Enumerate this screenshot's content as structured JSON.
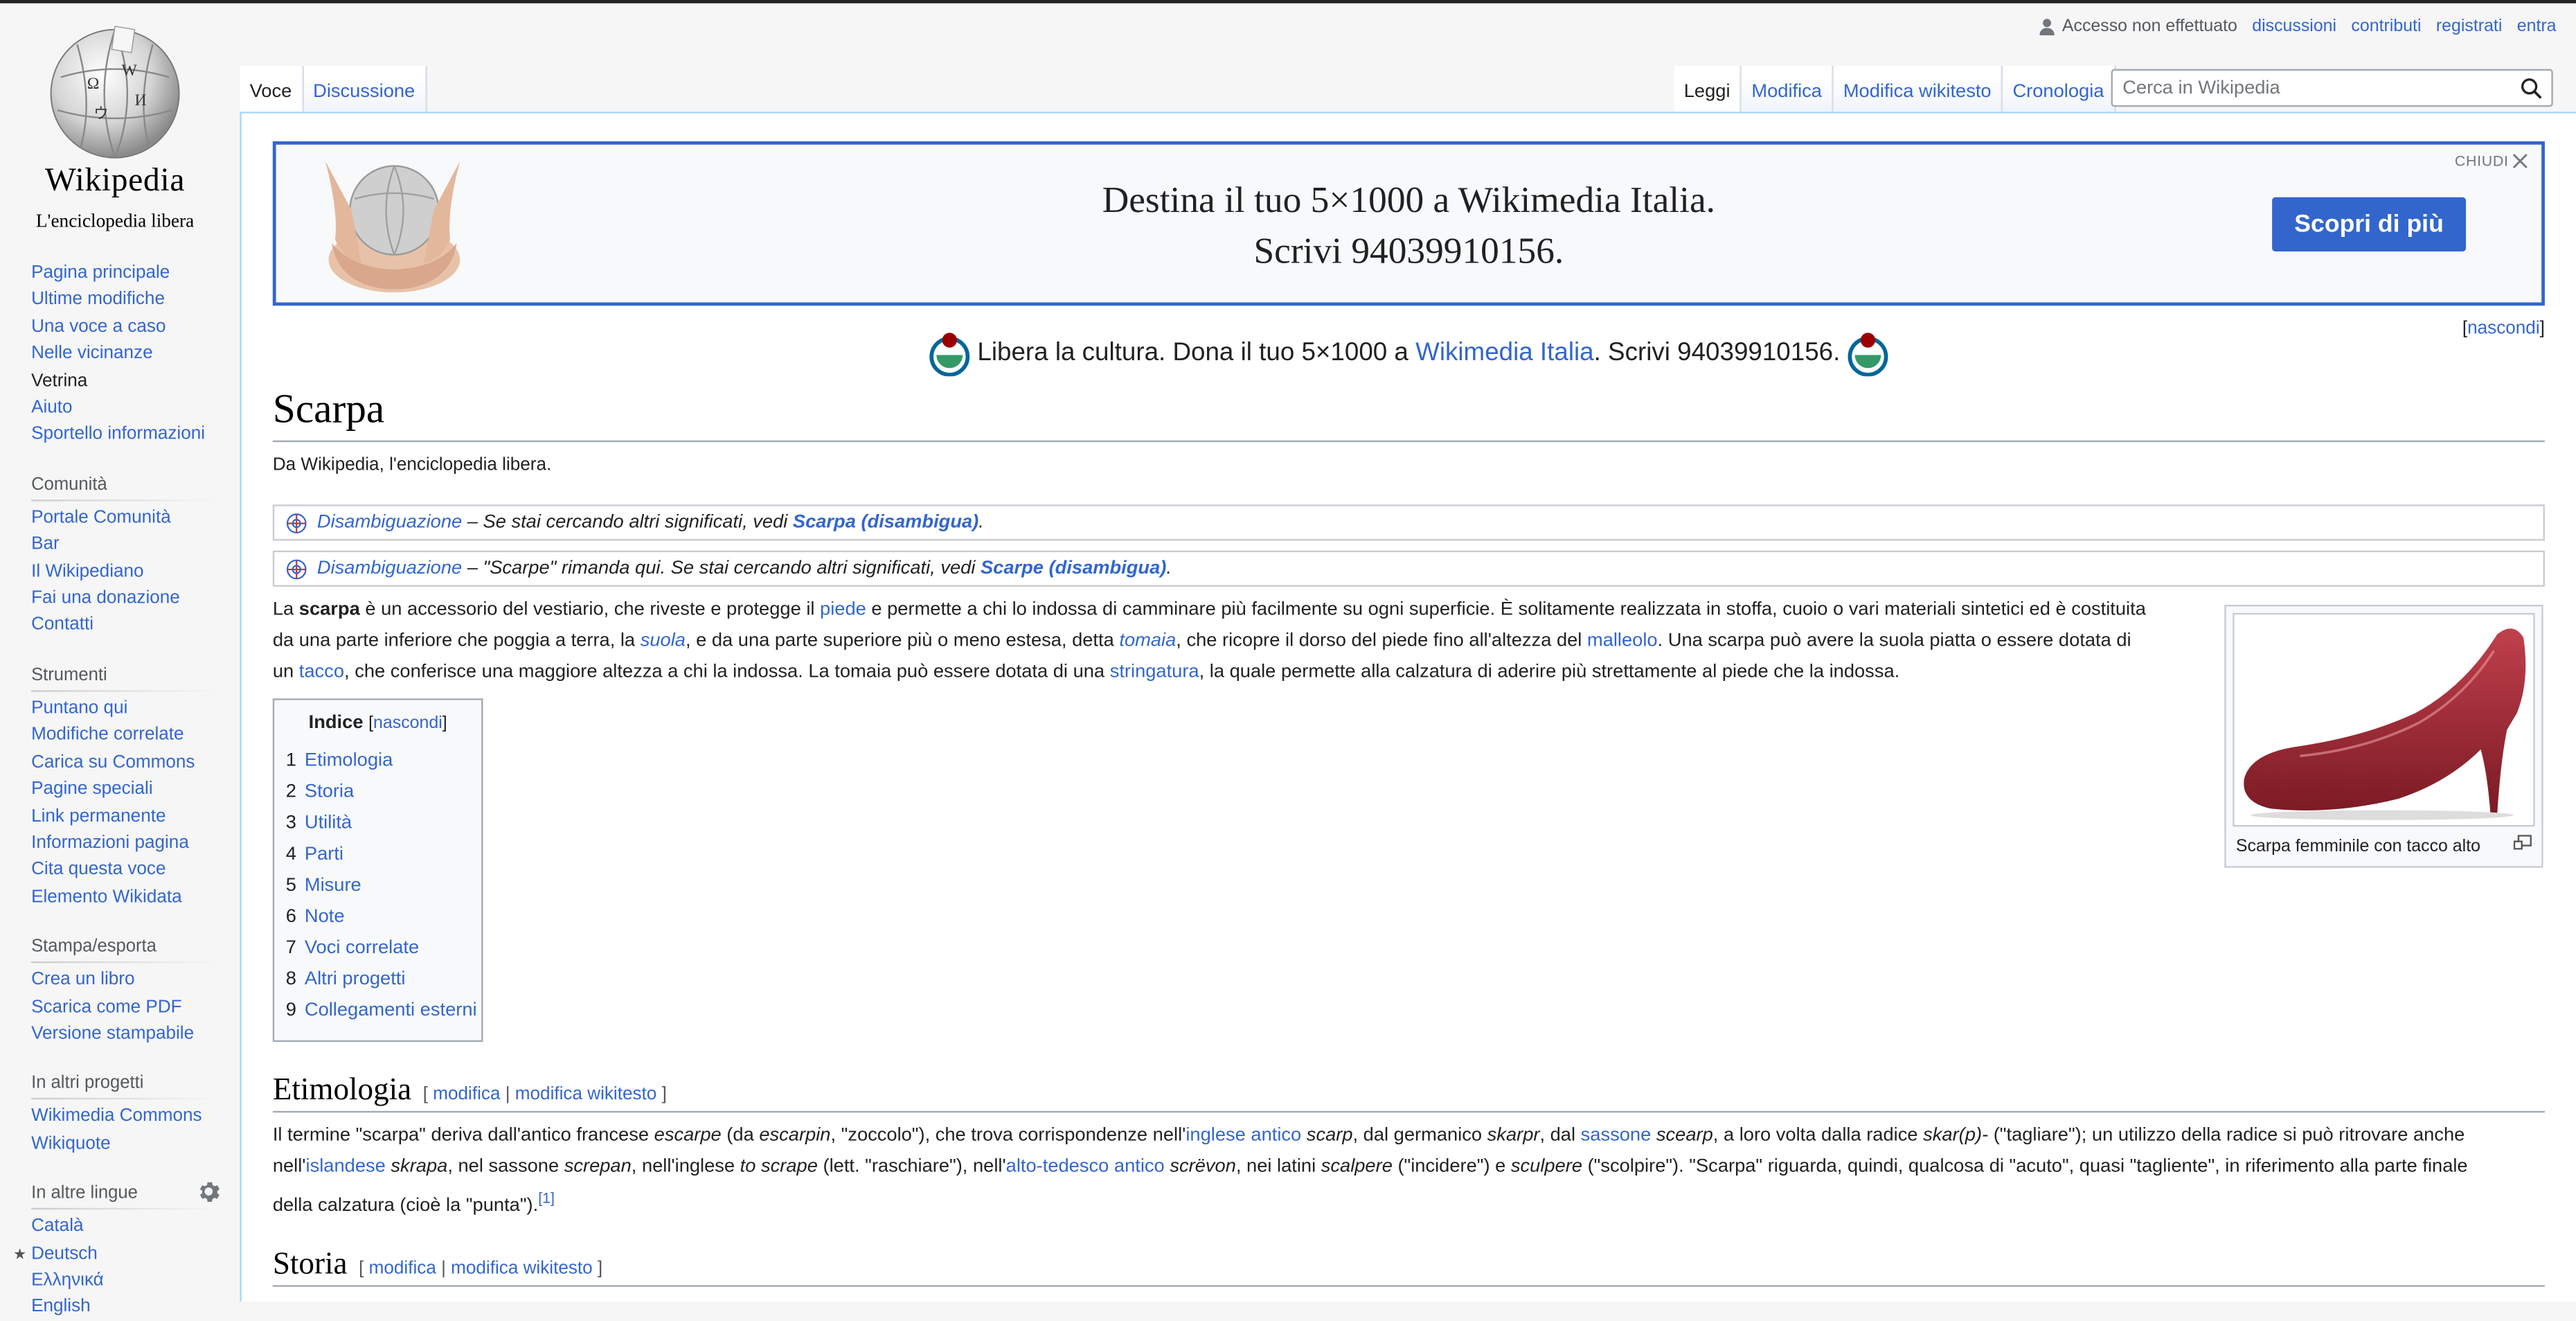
{
  "logo": {
    "wordmark": "Wikipedia",
    "tagline": "L'enciclopedia libera"
  },
  "sidebar": {
    "nav": [
      {
        "label": "Pagina principale",
        "plain": false
      },
      {
        "label": "Ultime modifiche",
        "plain": false
      },
      {
        "label": "Una voce a caso",
        "plain": false
      },
      {
        "label": "Nelle vicinanze",
        "plain": false
      },
      {
        "label": "Vetrina",
        "plain": true
      },
      {
        "label": "Aiuto",
        "plain": false
      },
      {
        "label": "Sportello informazioni",
        "plain": false
      }
    ],
    "community_heading": "Comunità",
    "community": [
      "Portale Comunità",
      "Bar",
      "Il Wikipediano",
      "Fai una donazione",
      "Contatti"
    ],
    "tools_heading": "Strumenti",
    "tools": [
      "Puntano qui",
      "Modifiche correlate",
      "Carica su Commons",
      "Pagine speciali",
      "Link permanente",
      "Informazioni pagina",
      "Cita questa voce",
      "Elemento Wikidata"
    ],
    "print_heading": "Stampa/esporta",
    "print": [
      "Crea un libro",
      "Scarica come PDF",
      "Versione stampabile"
    ],
    "projects_heading": "In altri progetti",
    "projects": [
      "Wikimedia Commons",
      "Wikiquote"
    ],
    "langs_heading": "In altre lingue",
    "langs": [
      "Català",
      "Deutsch",
      "Ελληνικά",
      "English"
    ]
  },
  "personal": {
    "anon": "Accesso non effettuato",
    "links": [
      "discussioni",
      "contributi",
      "registrati",
      "entra"
    ]
  },
  "tabs": {
    "left": [
      {
        "label": "Voce",
        "selected": true
      },
      {
        "label": "Discussione",
        "selected": false
      }
    ],
    "right": [
      {
        "label": "Leggi",
        "selected": true
      },
      {
        "label": "Modifica",
        "selected": false
      },
      {
        "label": "Modifica wikitesto",
        "selected": false
      },
      {
        "label": "Cronologia",
        "selected": false
      }
    ]
  },
  "search": {
    "placeholder": "Cerca in Wikipedia"
  },
  "banner": {
    "line1": "Destina il tuo 5×1000 a Wikimedia Italia.",
    "line2": "Scrivi 94039910156.",
    "cta": "Scopri di più",
    "close": "CHIUDI"
  },
  "sitenotice": {
    "before": "Libera la cultura. Dona il tuo 5×1000 a ",
    "link": "Wikimedia Italia",
    "after": ". Scrivi 94039910156.",
    "hide": "nascondi"
  },
  "article": {
    "title": "Scarpa",
    "subtitle": "Da Wikipedia, l'enciclopedia libera.",
    "dab1": {
      "link": "Disambiguazione",
      "text": " – Se stai cercando altri significati, vedi ",
      "target": "Scarpa (disambigua)",
      "end": "."
    },
    "dab2": {
      "link": "Disambiguazione",
      "text": " – \"Scarpe\" rimanda qui. Se stai cercando altri significati, vedi ",
      "target": "Scarpe (disambigua)",
      "end": "."
    },
    "intro": {
      "t1": "La ",
      "b1": "scarpa",
      "t2": " è un accessorio del vestiario, che riveste e protegge il ",
      "l1": "piede",
      "t3": " e permette a chi lo indossa di camminare più facilmente su ogni superficie. È solitamente realizzata in stoffa, cuoio o vari materiali sintetici ed è costituita",
      "t4": "da una parte inferiore che poggia a terra, la ",
      "l2": "suola",
      "t5": ", e da una parte superiore più o meno estesa, detta ",
      "l3": "tomaia",
      "t6": ", che ricopre il dorso del piede fino all'altezza del ",
      "l4": "malleolo",
      "t7": ". Una scarpa può avere la suola piatta o essere dotata di",
      "t8": "un ",
      "l5": "tacco",
      "t9": ", che conferisce una maggiore altezza a chi la indossa. La tomaia può essere dotata di una ",
      "l6": "stringatura",
      "t10": ", la quale permette alla calzatura di aderire più strettamente al piede che la indossa."
    },
    "thumb_caption": "Scarpa femminile con tacco alto",
    "toc": {
      "title": "Indice",
      "hide": "nascondi",
      "items": [
        {
          "num": "1",
          "label": "Etimologia"
        },
        {
          "num": "2",
          "label": "Storia"
        },
        {
          "num": "3",
          "label": "Utilità"
        },
        {
          "num": "4",
          "label": "Parti"
        },
        {
          "num": "5",
          "label": "Misure"
        },
        {
          "num": "6",
          "label": "Note"
        },
        {
          "num": "7",
          "label": "Voci correlate"
        },
        {
          "num": "8",
          "label": "Altri progetti"
        },
        {
          "num": "9",
          "label": "Collegamenti esterni"
        }
      ]
    },
    "edit_links": {
      "edit": "modifica",
      "sep": " | ",
      "edit_source": "modifica wikitesto"
    },
    "etimologia": {
      "heading": "Etimologia",
      "a1": "Il termine \"scarpa\" deriva dall'antico francese ",
      "i1": "escarpe",
      "a2": " (da ",
      "i2": "escarpin",
      "a3": ", \"zoccolo\"), che trova corrispondenze nell'",
      "l1": "inglese antico",
      "a4": " ",
      "i3": "scarp",
      "a5": ", dal germanico ",
      "i4": "skarpr",
      "a6": ", dal ",
      "l2": "sassone",
      "a7": " ",
      "i5": "scearp",
      "a8": ", a loro volta dalla radice ",
      "i6": "skar(p)-",
      "a9": " (\"tagliare\"); un utilizzo della radice si può ritrovare anche",
      "b0": "nell'",
      "l3": "islandese",
      "b1": " ",
      "i7": "skrapa",
      "b2": ", nel sassone ",
      "i8": "screpan",
      "b3": ", nell'inglese ",
      "i9": "to scrape",
      "b4": " (lett. \"raschiare\"), nell'",
      "l4": "alto-tedesco antico",
      "b5": " ",
      "i10": "scrëvon",
      "b6": ", nei latini ",
      "i11": "scalpere",
      "b7": " (\"incidere\") e ",
      "i12": "sculpere",
      "b8": " (\"scolpire\"). \"Scarpa\" riguarda, quindi, qualcosa di \"acuto\", quasi \"tagliente\", in riferimento alla parte finale",
      "c1": "della calzatura (cioè la \"punta\").",
      "ref": "[1]"
    },
    "storia": {
      "heading": "Storia"
    }
  }
}
